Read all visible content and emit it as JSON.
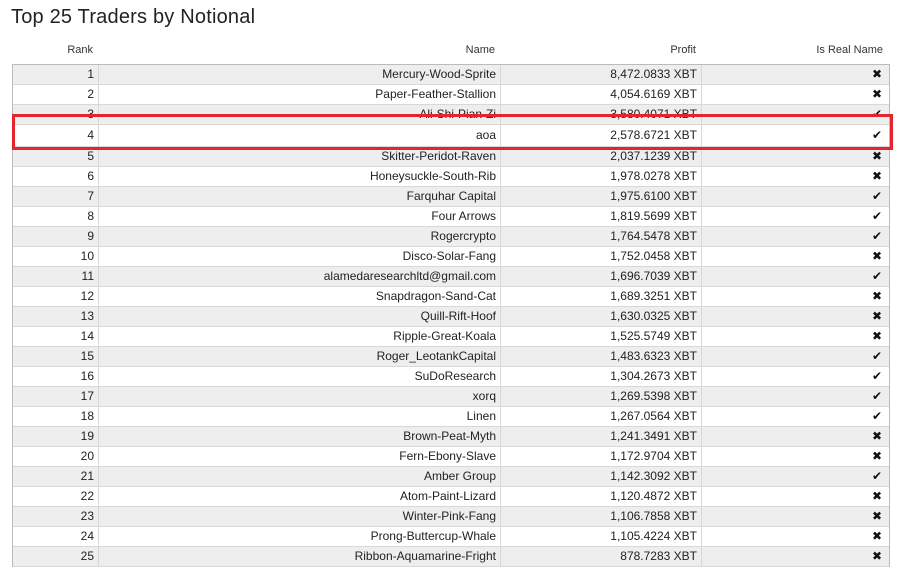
{
  "page": {
    "title": "Top 25 Traders by Notional"
  },
  "columns": {
    "rank": "Rank",
    "name": "Name",
    "profit": "Profit",
    "is_real_name": "Is Real Name"
  },
  "symbols": {
    "check": "✔",
    "cross": "✖"
  },
  "rows": [
    {
      "rank": "1",
      "name": "Mercury-Wood-Sprite",
      "profit": "8,472.0833 XBT",
      "real": "cross"
    },
    {
      "rank": "2",
      "name": "Paper-Feather-Stallion",
      "profit": "4,054.6169 XBT",
      "real": "cross"
    },
    {
      "rank": "3",
      "name": "Ali-Shi-Pian-Zi",
      "profit": "3,580.4071 XBT",
      "real": "check"
    },
    {
      "rank": "4",
      "name": "aoa",
      "profit": "2,578.6721 XBT",
      "real": "check"
    },
    {
      "rank": "5",
      "name": "Skitter-Peridot-Raven",
      "profit": "2,037.1239 XBT",
      "real": "cross"
    },
    {
      "rank": "6",
      "name": "Honeysuckle-South-Rib",
      "profit": "1,978.0278 XBT",
      "real": "cross"
    },
    {
      "rank": "7",
      "name": "Farquhar Capital",
      "profit": "1,975.6100 XBT",
      "real": "check"
    },
    {
      "rank": "8",
      "name": "Four Arrows",
      "profit": "1,819.5699 XBT",
      "real": "check"
    },
    {
      "rank": "9",
      "name": "Rogercrypto",
      "profit": "1,764.5478 XBT",
      "real": "check"
    },
    {
      "rank": "10",
      "name": "Disco-Solar-Fang",
      "profit": "1,752.0458 XBT",
      "real": "cross"
    },
    {
      "rank": "11",
      "name": "alamedaresearchltd@gmail.com",
      "profit": "1,696.7039 XBT",
      "real": "check"
    },
    {
      "rank": "12",
      "name": "Snapdragon-Sand-Cat",
      "profit": "1,689.3251 XBT",
      "real": "cross"
    },
    {
      "rank": "13",
      "name": "Quill-Rift-Hoof",
      "profit": "1,630.0325 XBT",
      "real": "cross"
    },
    {
      "rank": "14",
      "name": "Ripple-Great-Koala",
      "profit": "1,525.5749 XBT",
      "real": "cross"
    },
    {
      "rank": "15",
      "name": "Roger_LeotankCapital",
      "profit": "1,483.6323 XBT",
      "real": "check"
    },
    {
      "rank": "16",
      "name": "SuDoResearch",
      "profit": "1,304.2673 XBT",
      "real": "check"
    },
    {
      "rank": "17",
      "name": "xorq",
      "profit": "1,269.5398 XBT",
      "real": "check"
    },
    {
      "rank": "18",
      "name": "Linen",
      "profit": "1,267.0564 XBT",
      "real": "check"
    },
    {
      "rank": "19",
      "name": "Brown-Peat-Myth",
      "profit": "1,241.3491 XBT",
      "real": "cross"
    },
    {
      "rank": "20",
      "name": "Fern-Ebony-Slave",
      "profit": "1,172.9704 XBT",
      "real": "cross"
    },
    {
      "rank": "21",
      "name": "Amber Group",
      "profit": "1,142.3092 XBT",
      "real": "check"
    },
    {
      "rank": "22",
      "name": "Atom-Paint-Lizard",
      "profit": "1,120.4872 XBT",
      "real": "cross"
    },
    {
      "rank": "23",
      "name": "Winter-Pink-Fang",
      "profit": "1,106.7858 XBT",
      "real": "cross"
    },
    {
      "rank": "24",
      "name": "Prong-Buttercup-Whale",
      "profit": "1,105.4224 XBT",
      "real": "cross"
    },
    {
      "rank": "25",
      "name": "Ribbon-Aquamarine-Fright",
      "profit": "878.7283 XBT",
      "real": "cross"
    }
  ],
  "highlight": {
    "color": "#e3262c",
    "row_rank": "4"
  }
}
